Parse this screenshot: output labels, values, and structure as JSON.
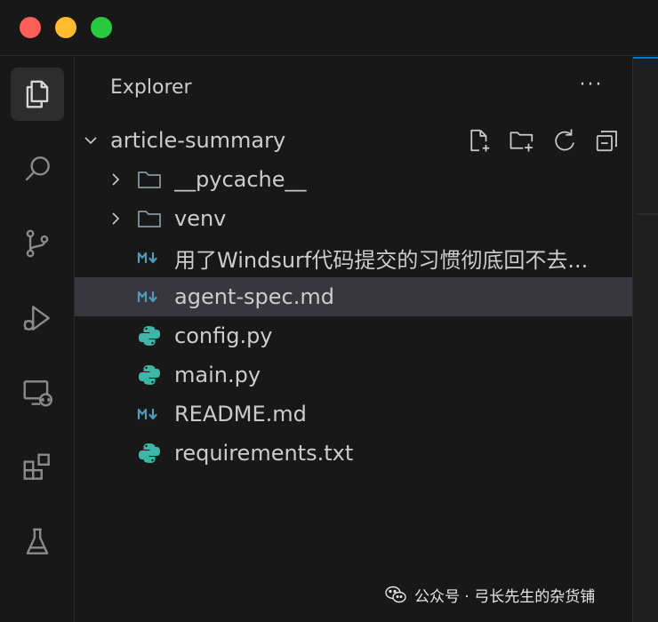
{
  "window": {
    "controls": [
      "close",
      "minimize",
      "maximize"
    ]
  },
  "activity_bar": {
    "items": [
      {
        "name": "explorer",
        "icon": "files-icon",
        "active": true
      },
      {
        "name": "search",
        "icon": "search-icon",
        "active": false
      },
      {
        "name": "source-control",
        "icon": "source-control-icon",
        "active": false
      },
      {
        "name": "run-debug",
        "icon": "run-debug-icon",
        "active": false
      },
      {
        "name": "remote-explorer",
        "icon": "remote-explorer-icon",
        "active": false
      },
      {
        "name": "extensions",
        "icon": "extensions-icon",
        "active": false
      },
      {
        "name": "testing",
        "icon": "beaker-icon",
        "active": false
      }
    ]
  },
  "explorer": {
    "title": "Explorer",
    "more_label": "···",
    "root": {
      "name": "article-summary",
      "expanded": true,
      "actions": [
        "new-file-icon",
        "new-folder-icon",
        "refresh-icon",
        "collapse-all-icon"
      ]
    },
    "items": [
      {
        "name": "__pycache__",
        "type": "folder"
      },
      {
        "name": "venv",
        "type": "folder"
      },
      {
        "name": "用了Windsurf代码提交的习惯彻底回不去...",
        "type": "markdown"
      },
      {
        "name": "agent-spec.md",
        "type": "markdown",
        "selected": true
      },
      {
        "name": "config.py",
        "type": "python"
      },
      {
        "name": "main.py",
        "type": "python"
      },
      {
        "name": "README.md",
        "type": "markdown"
      },
      {
        "name": "requirements.txt",
        "type": "python"
      }
    ]
  },
  "watermark": {
    "text": "公众号 · 弓长先生的杂货铺"
  },
  "colors": {
    "accent": "#0078d4",
    "python": "#3fb7a8",
    "markdown": "#519aba",
    "folder": "#8b93a1",
    "selection": "#37373d"
  }
}
